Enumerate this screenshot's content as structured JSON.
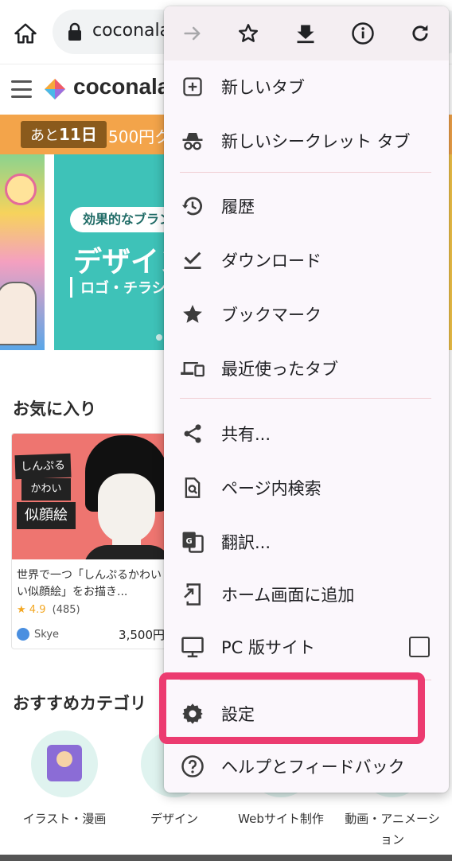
{
  "browser": {
    "url": "coconala",
    "toolbar_icons": [
      "home-icon",
      "lock-icon"
    ]
  },
  "site": {
    "logo": "coconala",
    "promo": {
      "days_prefix": "あと",
      "days_value": "11日",
      "text": "500円ク"
    },
    "banner": {
      "pill": "効果的なブラン",
      "title": "デザイン",
      "subtitle": "ロゴ・チラシ・"
    },
    "favorites": {
      "heading": "お気に入り",
      "card": {
        "image_text": [
          "しんぷる",
          "かわいい！",
          "似顔絵"
        ],
        "title": "世界で一つ「しんぷるかわいい似顔絵」をお描き...",
        "rating": "4.9",
        "reviews": "(485)",
        "seller": "Skye",
        "price": "3,500円"
      }
    },
    "categories": {
      "heading": "おすすめカテゴリ",
      "items": [
        {
          "label": "イラスト・漫画"
        },
        {
          "label": "デザイン"
        },
        {
          "label": "Webサイト制作"
        },
        {
          "label": "動画・アニメーション"
        }
      ]
    }
  },
  "menu": {
    "toolbar": [
      "forward-icon",
      "bookmark-star-icon",
      "download-icon",
      "info-icon",
      "reload-icon"
    ],
    "items": {
      "new_tab": "新しいタブ",
      "new_incognito": "新しいシークレット タブ",
      "history": "履歴",
      "downloads": "ダウンロード",
      "bookmarks": "ブックマーク",
      "recent_tabs": "最近使ったタブ",
      "share": "共有...",
      "find_in_page": "ページ内検索",
      "translate": "翻訳...",
      "add_to_home": "ホーム画面に追加",
      "desktop_site": "PC 版サイト",
      "settings": "設定",
      "help": "ヘルプとフィードバック"
    },
    "desktop_site_checked": false
  },
  "colors": {
    "highlight": "#ec3b70",
    "promo": "#f3a44a",
    "banner": "#3ec2b8"
  }
}
